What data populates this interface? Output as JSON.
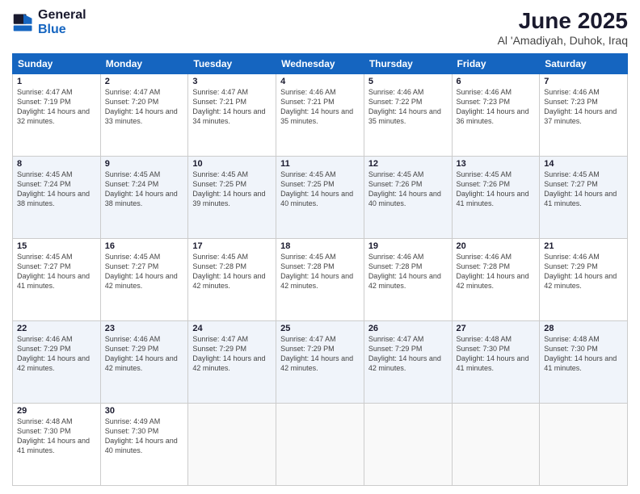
{
  "header": {
    "logo_general": "General",
    "logo_blue": "Blue",
    "month_title": "June 2025",
    "location": "Al 'Amadiyah, Duhok, Iraq"
  },
  "weekdays": [
    "Sunday",
    "Monday",
    "Tuesday",
    "Wednesday",
    "Thursday",
    "Friday",
    "Saturday"
  ],
  "weeks": [
    [
      {
        "day": "1",
        "sunrise": "4:47 AM",
        "sunset": "7:19 PM",
        "daylight": "14 hours and 32 minutes."
      },
      {
        "day": "2",
        "sunrise": "4:47 AM",
        "sunset": "7:20 PM",
        "daylight": "14 hours and 33 minutes."
      },
      {
        "day": "3",
        "sunrise": "4:47 AM",
        "sunset": "7:21 PM",
        "daylight": "14 hours and 34 minutes."
      },
      {
        "day": "4",
        "sunrise": "4:46 AM",
        "sunset": "7:21 PM",
        "daylight": "14 hours and 35 minutes."
      },
      {
        "day": "5",
        "sunrise": "4:46 AM",
        "sunset": "7:22 PM",
        "daylight": "14 hours and 35 minutes."
      },
      {
        "day": "6",
        "sunrise": "4:46 AM",
        "sunset": "7:23 PM",
        "daylight": "14 hours and 36 minutes."
      },
      {
        "day": "7",
        "sunrise": "4:46 AM",
        "sunset": "7:23 PM",
        "daylight": "14 hours and 37 minutes."
      }
    ],
    [
      {
        "day": "8",
        "sunrise": "4:45 AM",
        "sunset": "7:24 PM",
        "daylight": "14 hours and 38 minutes."
      },
      {
        "day": "9",
        "sunrise": "4:45 AM",
        "sunset": "7:24 PM",
        "daylight": "14 hours and 38 minutes."
      },
      {
        "day": "10",
        "sunrise": "4:45 AM",
        "sunset": "7:25 PM",
        "daylight": "14 hours and 39 minutes."
      },
      {
        "day": "11",
        "sunrise": "4:45 AM",
        "sunset": "7:25 PM",
        "daylight": "14 hours and 40 minutes."
      },
      {
        "day": "12",
        "sunrise": "4:45 AM",
        "sunset": "7:26 PM",
        "daylight": "14 hours and 40 minutes."
      },
      {
        "day": "13",
        "sunrise": "4:45 AM",
        "sunset": "7:26 PM",
        "daylight": "14 hours and 41 minutes."
      },
      {
        "day": "14",
        "sunrise": "4:45 AM",
        "sunset": "7:27 PM",
        "daylight": "14 hours and 41 minutes."
      }
    ],
    [
      {
        "day": "15",
        "sunrise": "4:45 AM",
        "sunset": "7:27 PM",
        "daylight": "14 hours and 41 minutes."
      },
      {
        "day": "16",
        "sunrise": "4:45 AM",
        "sunset": "7:27 PM",
        "daylight": "14 hours and 42 minutes."
      },
      {
        "day": "17",
        "sunrise": "4:45 AM",
        "sunset": "7:28 PM",
        "daylight": "14 hours and 42 minutes."
      },
      {
        "day": "18",
        "sunrise": "4:45 AM",
        "sunset": "7:28 PM",
        "daylight": "14 hours and 42 minutes."
      },
      {
        "day": "19",
        "sunrise": "4:46 AM",
        "sunset": "7:28 PM",
        "daylight": "14 hours and 42 minutes."
      },
      {
        "day": "20",
        "sunrise": "4:46 AM",
        "sunset": "7:28 PM",
        "daylight": "14 hours and 42 minutes."
      },
      {
        "day": "21",
        "sunrise": "4:46 AM",
        "sunset": "7:29 PM",
        "daylight": "14 hours and 42 minutes."
      }
    ],
    [
      {
        "day": "22",
        "sunrise": "4:46 AM",
        "sunset": "7:29 PM",
        "daylight": "14 hours and 42 minutes."
      },
      {
        "day": "23",
        "sunrise": "4:46 AM",
        "sunset": "7:29 PM",
        "daylight": "14 hours and 42 minutes."
      },
      {
        "day": "24",
        "sunrise": "4:47 AM",
        "sunset": "7:29 PM",
        "daylight": "14 hours and 42 minutes."
      },
      {
        "day": "25",
        "sunrise": "4:47 AM",
        "sunset": "7:29 PM",
        "daylight": "14 hours and 42 minutes."
      },
      {
        "day": "26",
        "sunrise": "4:47 AM",
        "sunset": "7:29 PM",
        "daylight": "14 hours and 42 minutes."
      },
      {
        "day": "27",
        "sunrise": "4:48 AM",
        "sunset": "7:30 PM",
        "daylight": "14 hours and 41 minutes."
      },
      {
        "day": "28",
        "sunrise": "4:48 AM",
        "sunset": "7:30 PM",
        "daylight": "14 hours and 41 minutes."
      }
    ],
    [
      {
        "day": "29",
        "sunrise": "4:48 AM",
        "sunset": "7:30 PM",
        "daylight": "14 hours and 41 minutes."
      },
      {
        "day": "30",
        "sunrise": "4:49 AM",
        "sunset": "7:30 PM",
        "daylight": "14 hours and 40 minutes."
      },
      null,
      null,
      null,
      null,
      null
    ]
  ]
}
